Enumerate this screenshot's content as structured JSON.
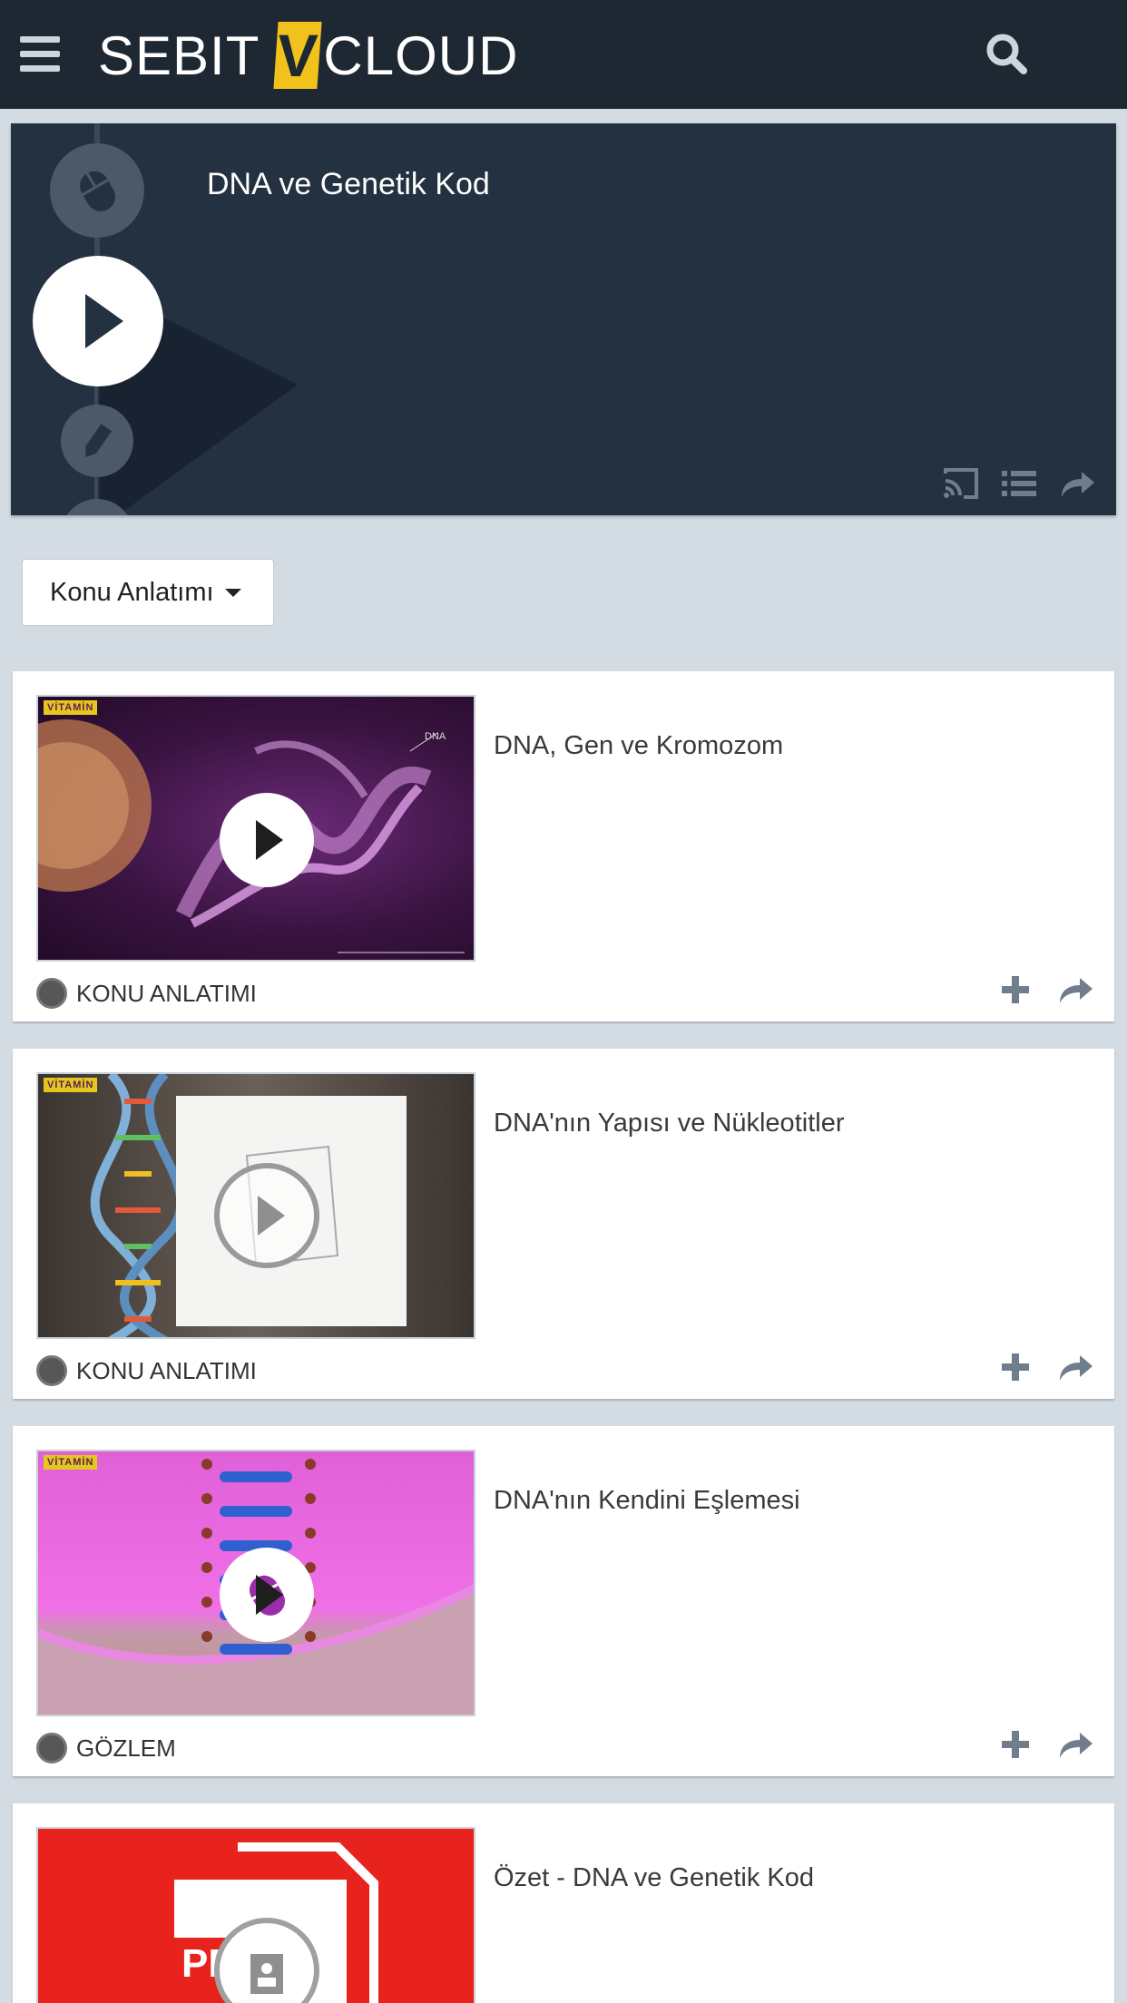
{
  "header": {
    "logo_left": "SEBIT",
    "logo_mark": "V",
    "logo_right": "CLOUD",
    "menu_icon": "hamburger-icon",
    "search_icon": "search-icon"
  },
  "hero": {
    "title": "DNA ve Genetik Kod",
    "tools": [
      "cast-icon",
      "list-icon",
      "share-icon"
    ]
  },
  "filter": {
    "selected": "Konu Anlatımı"
  },
  "items": [
    {
      "title": "DNA, Gen ve Kromozom",
      "category": "KONU ANLATIMI",
      "badge": "VİTAMİN",
      "thumb_overlay": "DNA"
    },
    {
      "title": "DNA'nın Yapısı ve Nükleotitler",
      "category": "KONU ANLATIMI",
      "badge": "VİTAMİN"
    },
    {
      "title": "DNA'nın Kendini Eşlemesi",
      "category": "GÖZLEM",
      "badge": "VİTAMİN"
    },
    {
      "title": "Özet - DNA ve Genetik Kod",
      "category": "",
      "thumb_overlay": "PD"
    }
  ],
  "colors": {
    "topbar": "#1e2833",
    "hero": "#233140",
    "accent": "#f1c21b",
    "page_bg": "#d3dbe3"
  }
}
